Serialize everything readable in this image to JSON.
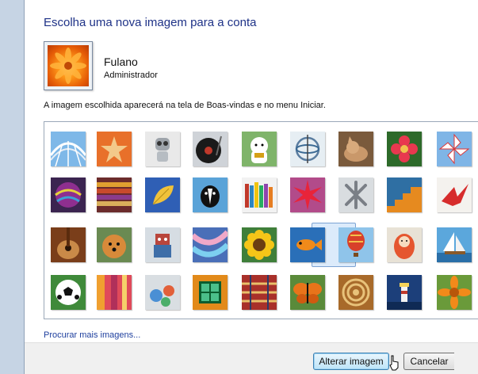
{
  "dialog": {
    "title": "Escolha uma nova imagem para a conta",
    "account_name": "Fulano",
    "account_role": "Administrador",
    "info_text": "A imagem escolhida aparecerá na tela de Boas-vindas e no menu Iniciar.",
    "more_link": "Procurar mais imagens...",
    "change_button": "Alterar imagem",
    "cancel_button": "Cancelar"
  },
  "gallery": {
    "selected": "fish",
    "rows": [
      [
        "roller-coaster",
        "starfish",
        "robot-toy",
        "turntable",
        "lucky-cat",
        "gyroscope",
        "kitten",
        "flower",
        "pinwheel"
      ],
      [
        "ball",
        "fabric-stack",
        "leaf",
        "dog",
        "crayons",
        "red-star",
        "jacks",
        "stairs",
        "paper-crane"
      ],
      [
        "guitar",
        "pomeranian",
        "toy-robot",
        "scarves",
        "sunflower",
        "fish",
        "hot-air-balloon",
        "doll",
        "sailboat"
      ],
      [
        "soccer-ball",
        "fabric",
        "marbles",
        "window",
        "rug",
        "butterfly",
        "shell",
        "lighthouse",
        "orange-flower"
      ]
    ]
  }
}
